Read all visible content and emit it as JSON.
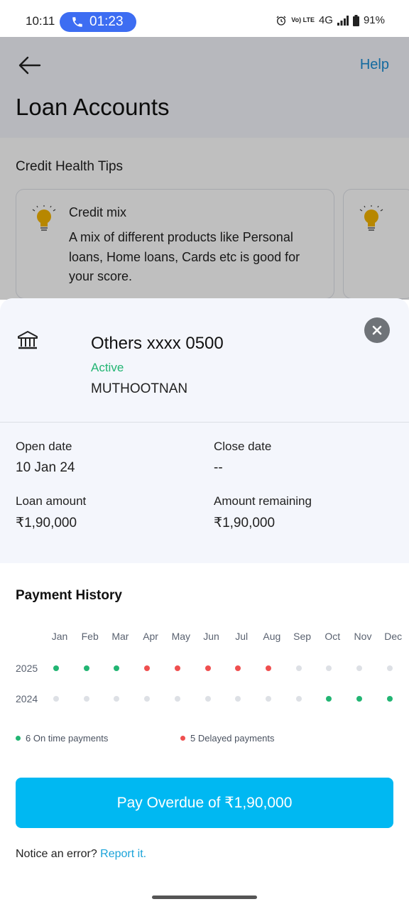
{
  "status_bar": {
    "time": "10:11",
    "call_timer": "01:23",
    "battery": "91%",
    "network": "4G",
    "volte": "Vo) LTE"
  },
  "header": {
    "title": "Loan Accounts",
    "help_label": "Help"
  },
  "tips": {
    "heading": "Credit Health Tips",
    "cards": [
      {
        "title": "Credit mix",
        "text": "A mix of different products like Personal loans, Home loans, Cards etc is good for your score."
      }
    ]
  },
  "account": {
    "name": "Others xxxx 0500",
    "status": "Active",
    "lender": "MUTHOOTNAN",
    "open_date_label": "Open date",
    "open_date": "10 Jan 24",
    "close_date_label": "Close date",
    "close_date": "--",
    "loan_amount_label": "Loan amount",
    "loan_amount": "₹1,90,000",
    "remaining_label": "Amount remaining",
    "remaining": "₹1,90,000"
  },
  "payment_history": {
    "title": "Payment History",
    "months": [
      "Jan",
      "Feb",
      "Mar",
      "Apr",
      "May",
      "Jun",
      "Jul",
      "Aug",
      "Sep",
      "Oct",
      "Nov",
      "Dec"
    ],
    "rows": [
      {
        "year": "2025",
        "status": [
          "ontime",
          "ontime",
          "ontime",
          "delayed",
          "delayed",
          "delayed",
          "delayed",
          "delayed",
          "none",
          "none",
          "none",
          "none"
        ]
      },
      {
        "year": "2024",
        "status": [
          "none",
          "none",
          "none",
          "none",
          "none",
          "none",
          "none",
          "none",
          "none",
          "ontime",
          "ontime",
          "ontime"
        ]
      }
    ],
    "legend_ontime": "6 On time payments",
    "legend_delayed": "5 Delayed payments",
    "colors": {
      "ontime": "#22b573",
      "delayed": "#ef4f4f",
      "none": "#dde0e5"
    }
  },
  "cta": {
    "pay_label": "Pay Overdue of ₹1,90,000"
  },
  "notice": {
    "text": "Notice an error?",
    "link": "Report it."
  }
}
